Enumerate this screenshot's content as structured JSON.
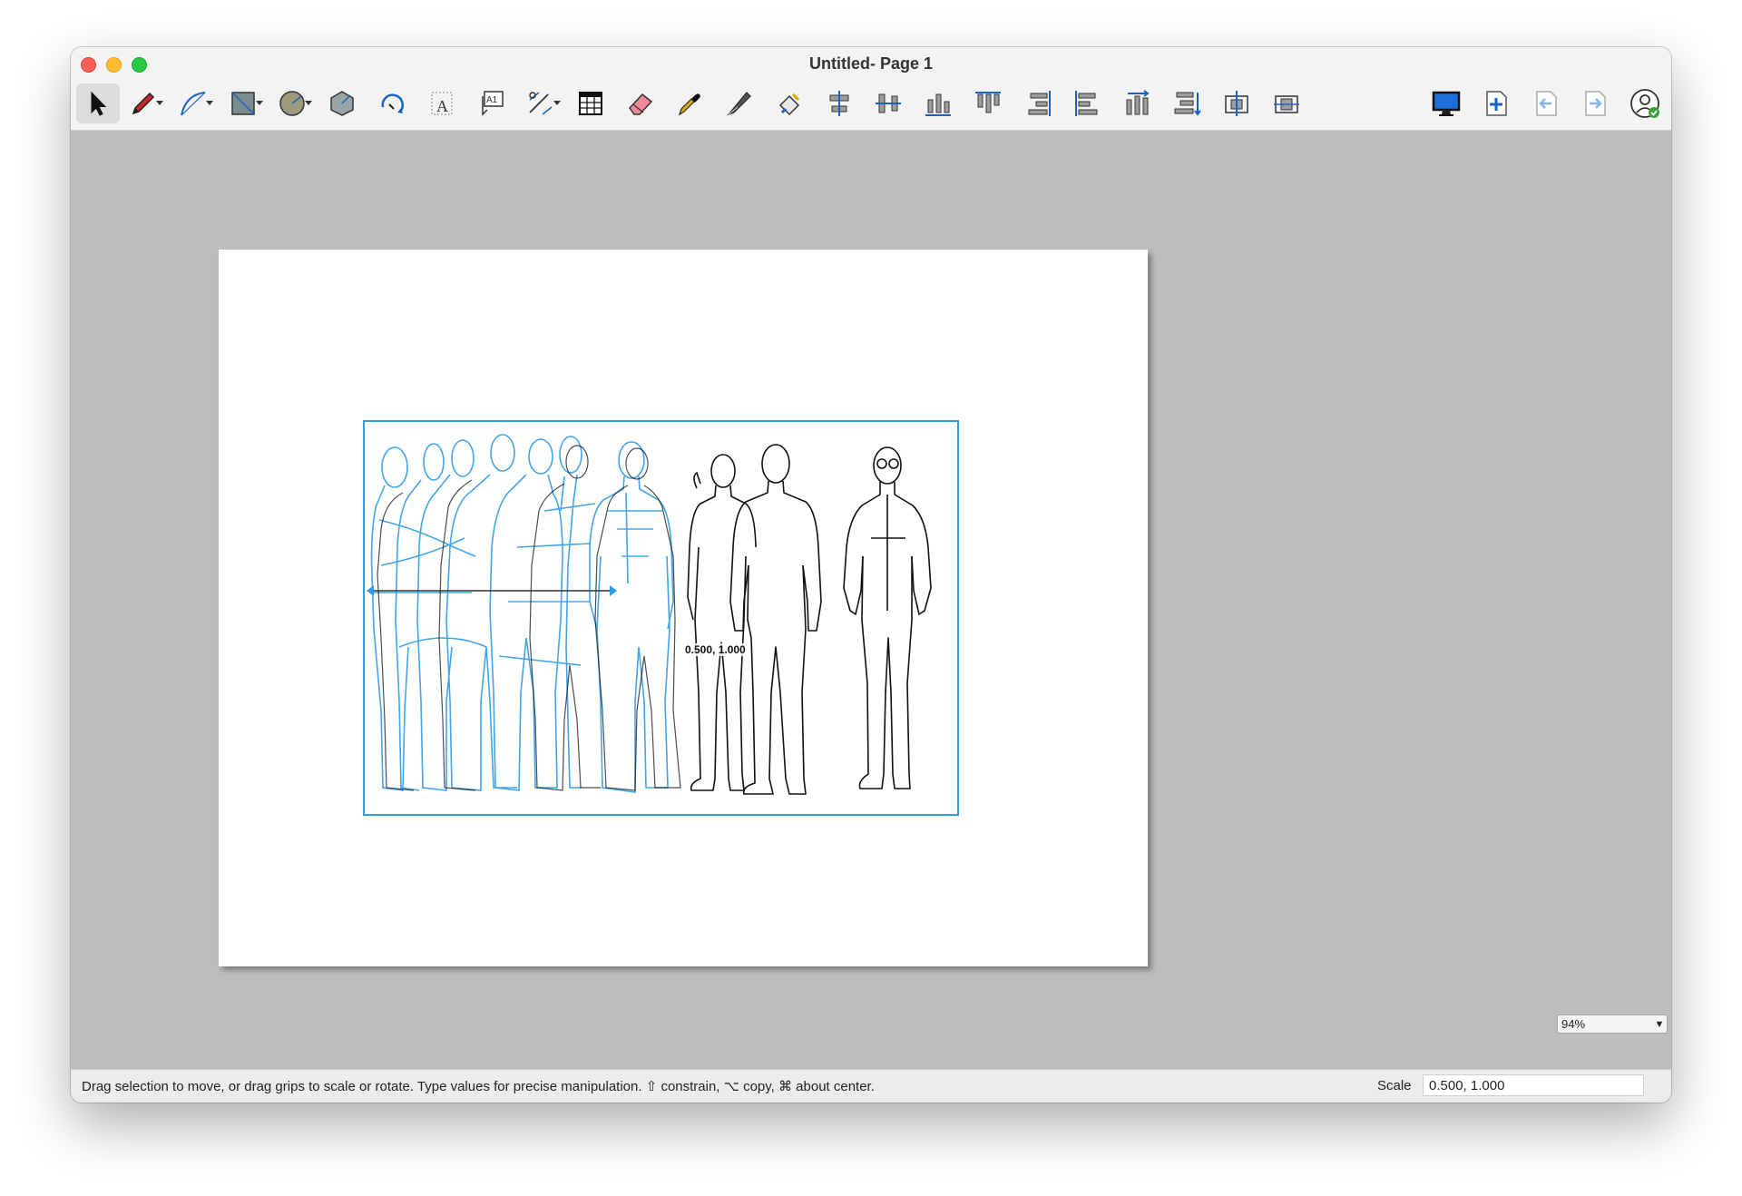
{
  "window": {
    "title": "Untitled- Page 1"
  },
  "toolbar": {
    "tools": [
      {
        "name": "select-tool-icon",
        "selected": true
      },
      {
        "name": "pencil-tool-icon",
        "has_menu": true
      },
      {
        "name": "curve-tool-icon",
        "has_menu": true
      },
      {
        "name": "rectangle-tool-icon",
        "has_menu": true
      },
      {
        "name": "circle-tool-icon",
        "has_menu": true
      },
      {
        "name": "polygon-tool-icon"
      },
      {
        "name": "rotate-tool-icon"
      },
      {
        "name": "text-tool-icon"
      },
      {
        "name": "label-tool-icon"
      },
      {
        "name": "dimension-tool-icon",
        "has_menu": true
      },
      {
        "name": "table-tool-icon"
      },
      {
        "name": "eraser-tool-icon"
      },
      {
        "name": "eyedropper-tool-icon"
      },
      {
        "name": "knife-tool-icon"
      },
      {
        "name": "paint-bucket-tool-icon"
      },
      {
        "name": "align-center-horizontal-icon"
      },
      {
        "name": "align-center-vertical-icon"
      },
      {
        "name": "align-bottom-icon"
      },
      {
        "name": "align-top-icon"
      },
      {
        "name": "align-right-icon"
      },
      {
        "name": "align-left-icon"
      },
      {
        "name": "distribute-horizontal-icon"
      },
      {
        "name": "distribute-vertical-icon"
      },
      {
        "name": "group-center-icon"
      },
      {
        "name": "ungroup-icon"
      },
      {
        "name": "display-icon"
      },
      {
        "name": "add-page-icon"
      },
      {
        "name": "previous-page-icon"
      },
      {
        "name": "next-page-icon"
      },
      {
        "name": "account-icon"
      }
    ]
  },
  "canvas": {
    "coordinate_readout": "0.500, 1.000",
    "selection_color": "#2d9ce8"
  },
  "zoom": {
    "value": "94%"
  },
  "status": {
    "hint": "Drag selection to move, or drag grips to scale or rotate. Type values for precise manipulation. ⇧ constrain, ⌥ copy, ⌘ about center.",
    "scale_label": "Scale",
    "scale_value": "0.500, 1.000"
  }
}
